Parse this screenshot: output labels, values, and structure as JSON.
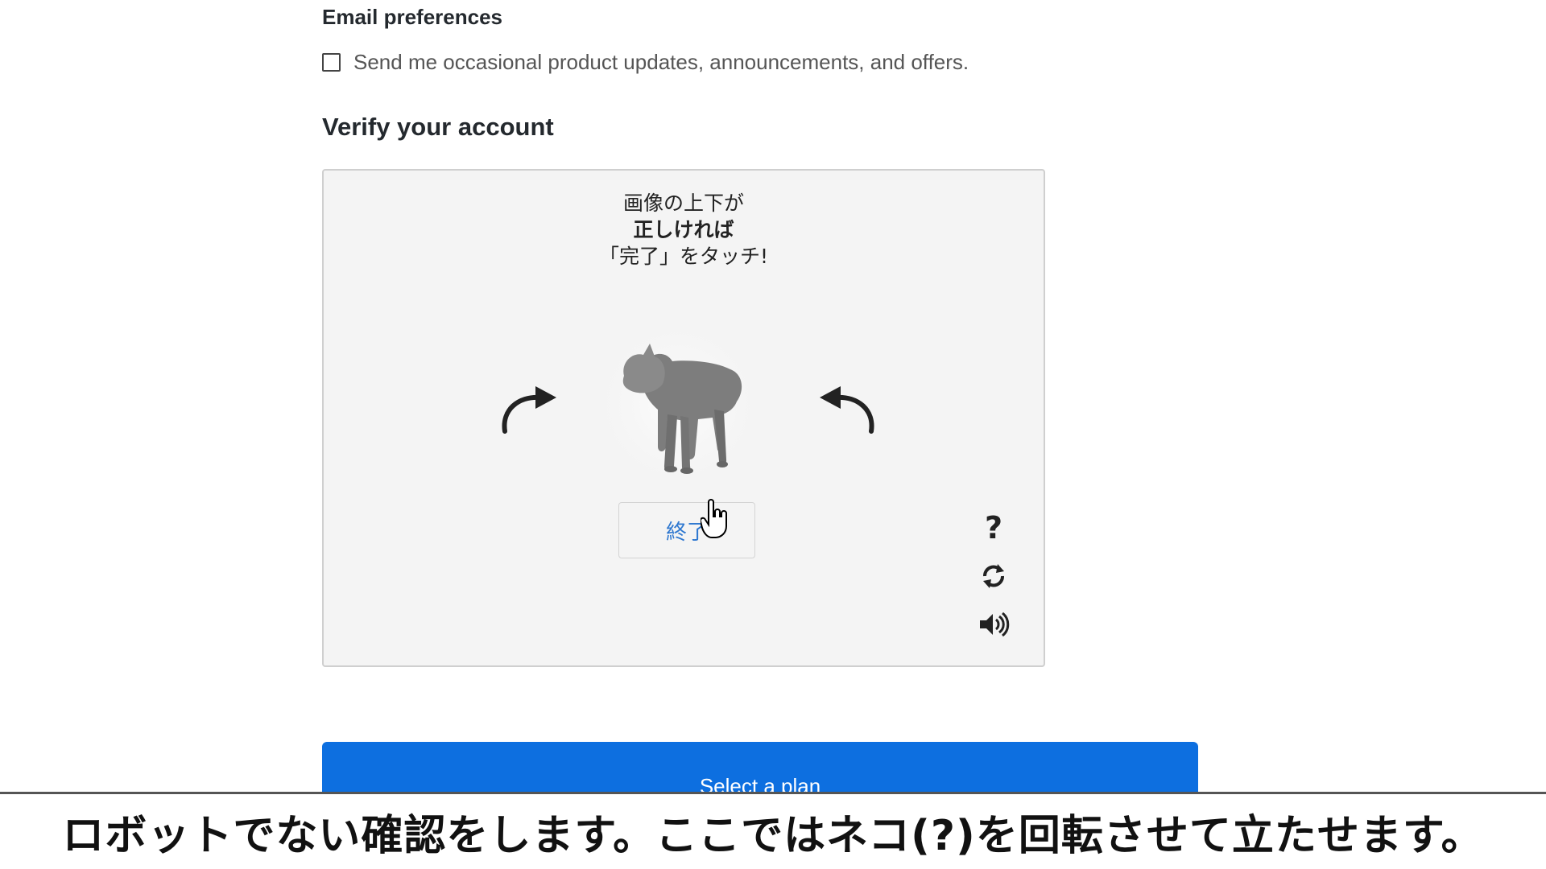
{
  "email_preferences": {
    "heading": "Email preferences",
    "checkbox_label": "Send me occasional product updates, announcements, and offers.",
    "checked": false
  },
  "verify": {
    "heading": "Verify your account",
    "captcha": {
      "instruction_line1": "画像の上下が",
      "instruction_line2": "正しければ",
      "instruction_line3": "「完了」をタッチ!",
      "done_label": "終了",
      "image_subject": "cat-figure-image",
      "rotate_left_icon": "rotate-left-arrow-icon",
      "rotate_right_icon": "rotate-right-arrow-icon",
      "help_label": "?",
      "refresh_icon": "refresh-icon",
      "audio_icon": "speaker-icon"
    }
  },
  "plan_button": {
    "label": "Select a plan",
    "color": "#0d6fe0"
  },
  "caption": {
    "text": "ロボットでない確認をします。ここではネコ(?)を回転させて立たせます。"
  }
}
